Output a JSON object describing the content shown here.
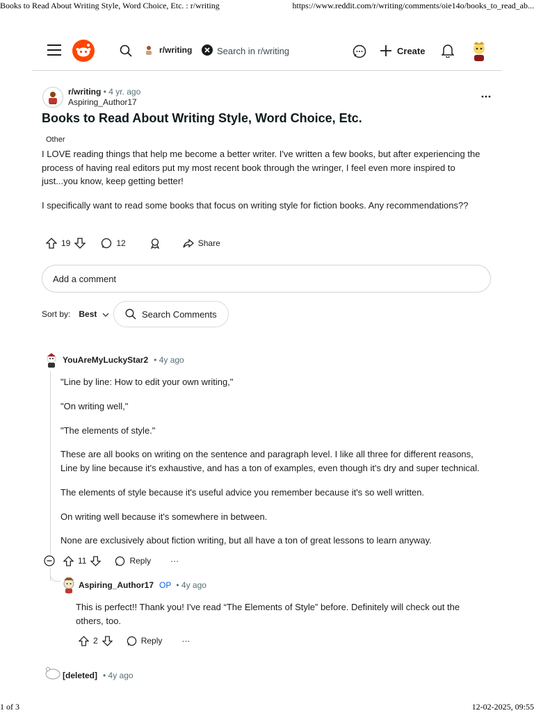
{
  "print": {
    "header_left": "Books to Read About Writing Style, Word Choice, Etc. : r/writing",
    "header_right": "https://www.reddit.com/r/writing/comments/oie14o/books_to_read_ab...",
    "footer_left": "1 of 3",
    "footer_right": "12-02-2025, 09:55"
  },
  "nav": {
    "subreddit_chip": "r/writing",
    "search_placeholder": "Search in r/writing",
    "create_label": "Create"
  },
  "post": {
    "subreddit": "r/writing",
    "age": "• 4 yr. ago",
    "author": "Aspiring_Author17",
    "title": "Books to Read About Writing Style, Word Choice, Etc.",
    "flair": "Other",
    "body": [
      "I LOVE reading things that help me become a better writer. I've written a few books, but after experiencing the process of having real editors put my most recent book through the wringer, I feel even more inspired to just...you know, keep getting better!",
      "I specifically want to read some books that focus on writing style for fiction books. Any recommendations??"
    ],
    "votes": "19",
    "comments": "12",
    "share_label": "Share"
  },
  "comment_box": {
    "placeholder": "Add a comment"
  },
  "sort": {
    "label": "Sort by:",
    "value": "Best"
  },
  "search_comments": {
    "label": "Search Comments"
  },
  "comments": [
    {
      "author": "YouAreMyLuckyStar2",
      "age": "• 4y ago",
      "body": [
        "\"Line by line: How to edit your own writing,\"",
        "\"On writing well,\"",
        "\"The elements of style.\"",
        "These are all books on writing on the sentence and paragraph level. I like all three for different reasons, Line by line because it's exhaustive, and has a ton of examples, even though it's dry and super technical.",
        "The elements of style because it's useful advice you remember because it's so well written.",
        "On writing well because it's somewhere in between.",
        "None are exclusively about fiction writing, but all have a ton of great lessons to learn anyway."
      ],
      "votes": "11",
      "reply_label": "Reply",
      "more": "···"
    },
    {
      "author": "Aspiring_Author17",
      "op_badge": "OP",
      "age": "• 4y ago",
      "body": [
        "This is perfect!! Thank you! I've read “The Elements of Style” before. Definitely will check out the others, too."
      ],
      "votes": "2",
      "reply_label": "Reply",
      "more": "···"
    },
    {
      "author": "[deleted]",
      "age": "• 4y ago"
    }
  ],
  "colors": {
    "brand": "#ff4500",
    "op_blue": "#0a65d6",
    "muted": "#576f76",
    "border": "#d6d6d6"
  },
  "icons": [
    "hamburger-icon",
    "reddit-logo-icon",
    "search-icon",
    "clear-icon",
    "chat-icon",
    "plus-icon",
    "bell-icon",
    "user-avatar-icon",
    "more-icon",
    "upvote-icon",
    "downvote-icon",
    "comment-icon",
    "award-icon",
    "share-icon",
    "chevron-down-icon",
    "collapse-icon"
  ]
}
